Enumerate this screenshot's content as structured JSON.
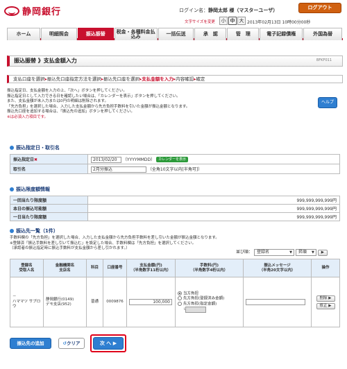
{
  "header": {
    "bank_name": "静岡銀行",
    "login_text": "ログイン名：",
    "user_name": "静岡太郎 様（マスターユーザ）",
    "logout_label": "ログアウト",
    "font_size_label": "文字サイズを変更",
    "font_sizes": [
      "小",
      "中",
      "大"
    ],
    "datetime": "2013年02月13日 10時00分00秒"
  },
  "nav": {
    "items": [
      {
        "label": "ホーム"
      },
      {
        "label": "明細照会"
      },
      {
        "label": "振込振替"
      },
      {
        "label": "税金・各種料金払込み"
      },
      {
        "label": "一括伝送"
      },
      {
        "label": "承　認"
      },
      {
        "label": "管　理"
      },
      {
        "label": "電子記録債権"
      },
      {
        "label": "外国為替"
      }
    ]
  },
  "page": {
    "title": "振込振替 》支払金額入力",
    "screen_id": "BFKF011"
  },
  "steps": {
    "s1": "支払口座を選択",
    "s2": "振込先口座指定方法を選択",
    "s3": "振込先口座を選択",
    "s4": "支払金額を入力",
    "s5": "内容確認",
    "s6": "確定"
  },
  "instructions": {
    "line1": "振込指定日、支払金額を入力の上、「次へ」ボタンを押してください。",
    "line2": "振込指定日として入力できる日を確認したい場合は、「カレンダーを表示」ボタンを押してください。",
    "line3": "また、支払金額が未入力または0円の明細は削除されます。",
    "line4": "「先方負担」を選択した場合、入力した支払金額から先方負担手数料を引いた金額が振込金額となります。",
    "line5": "振込先口座を追加する場合は、「振込先の追加」ボタンを押してください。",
    "line6": "※は必須入力項目です。",
    "help_label": "ヘルプ"
  },
  "section1": {
    "title": "振込指定日・取引名",
    "date_label": "振込指定日",
    "date_value": "2013/02/20",
    "date_format": "（YYYYMMDD）",
    "calendar_label": "カレンダーを表示",
    "name_label": "取引名",
    "name_value": "2月分振込",
    "name_hint": "（全角10文字以内[半角可]）"
  },
  "section2": {
    "title": "振込限度額情報",
    "rows": [
      {
        "label": "一回当たり限度額",
        "value": "999,999,999,999円"
      },
      {
        "label": "本日の振込可能額",
        "value": "999,999,999,999円"
      },
      {
        "label": "一日当たり限度額",
        "value": "999,999,999,999円"
      }
    ]
  },
  "section3": {
    "title": "振込先一覧（1件）",
    "note1": "手数料欄の「先方負担」を選択した場合、入力した支払金額から先方負担手数料を差し引いた金額が振込金額となります。",
    "note2": "※登録済「振込手数料を差し引いて振込む」を設定した場合、手数料欄は「先方負担」を選択してください。",
    "note3": "（承認者の振込指定時に振込手数料が支払金額から差し引かれます。）",
    "sort_label": "並び順：",
    "sort_value": "登録名",
    "order_value": "昇順",
    "headers": {
      "h1a": "登録名",
      "h1b": "受取人名",
      "h2a": "金融機関名",
      "h2b": "支店名",
      "h3": "科目",
      "h4": "口座番号",
      "h5a": "支払金額(円)",
      "h5b": "（半角数字11桁以内）",
      "h6a": "手数料(円)",
      "h6b": "（半角数字4桁以内）",
      "h7a": "振込メッセージ",
      "h7b": "（半角20文字以内）",
      "h8": "操作"
    },
    "row": {
      "reg_name": "－",
      "recipient": "ハママツ サブロウ",
      "bank": "静岡銀行(0149)",
      "branch": "デモ支店(952)",
      "type": "普通",
      "account": "0009876",
      "amount": "100,000",
      "fee_opt1": "当方負担",
      "fee_opt2": "先方負担(登録済み金額)",
      "fee_opt3": "先方負担(指定金額)",
      "delete_label": "削除",
      "edit_label": "修正"
    }
  },
  "actions": {
    "add_label": "振込先の追加",
    "clear_label": "クリア",
    "next_label": "次 へ"
  }
}
